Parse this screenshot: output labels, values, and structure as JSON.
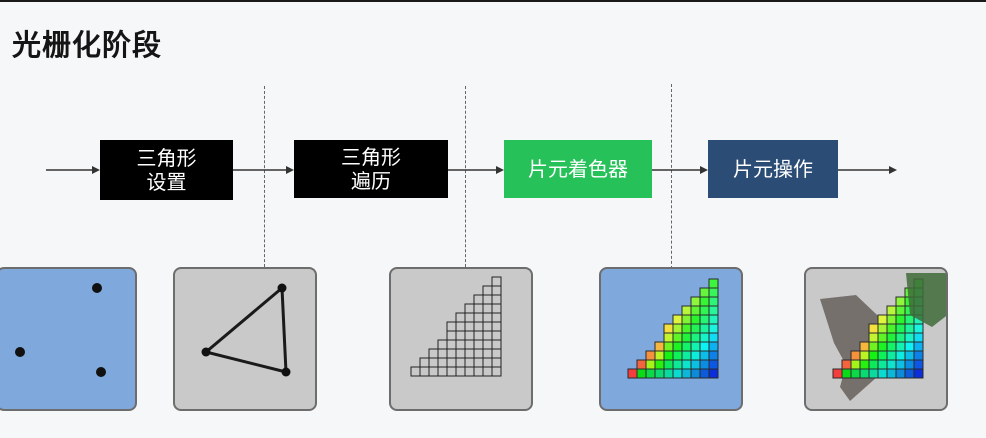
{
  "title": "光栅化阶段",
  "stages": [
    {
      "label": "三角形\n设置",
      "color": "#000000"
    },
    {
      "label": "三角形\n遍历",
      "color": "#000000"
    },
    {
      "label": "片元着色器",
      "color": "#27c15a"
    },
    {
      "label": "片元操作",
      "color": "#2b4c74"
    }
  ],
  "colors": {
    "panel_blue": "#7fa8dc",
    "panel_gray": "#c9c9c9",
    "arrow": "#333333"
  },
  "panels": [
    {
      "name": "vertices-panel",
      "depicts": "three-points"
    },
    {
      "name": "triangle-panel",
      "depicts": "triangle-outline"
    },
    {
      "name": "fragment-grid-panel",
      "depicts": "fragment-grid"
    },
    {
      "name": "shaded-fragments-panel",
      "depicts": "colored-fragments"
    },
    {
      "name": "blended-fragments-panel",
      "depicts": "blended-fragments"
    }
  ]
}
